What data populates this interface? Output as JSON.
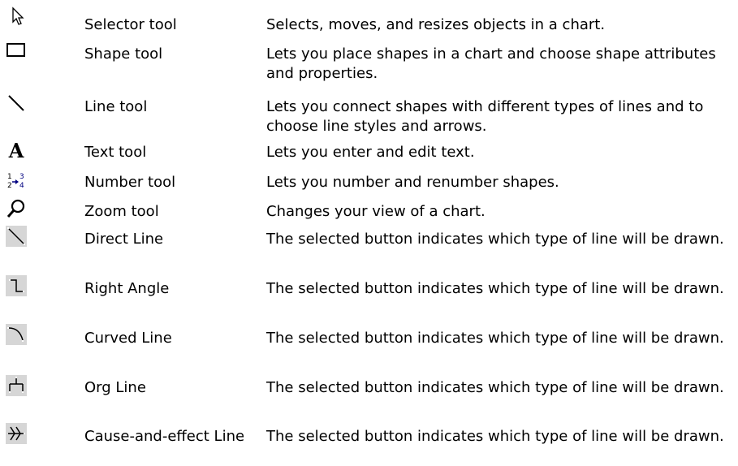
{
  "tools": [
    {
      "icon": "selector-arrow-icon",
      "name": "Selector tool",
      "description": "Selects, moves, and resizes objects in a chart."
    },
    {
      "icon": "rectangle-shape-icon",
      "name": "Shape tool",
      "description": "Lets you place shapes in a chart and choose shape attributes and properties."
    },
    {
      "icon": "diagonal-line-icon",
      "name": "Line tool",
      "description": "Lets you connect shapes with different types of lines and to choose line styles and arrows."
    },
    {
      "icon": "letter-a-icon",
      "name": "Text tool",
      "description": "Lets you enter and edit text."
    },
    {
      "icon": "numbering-icon",
      "name": "Number tool",
      "description": "Lets you number and renumber shapes."
    },
    {
      "icon": "magnifier-icon",
      "name": "Zoom tool",
      "description": "Changes your view of a chart."
    },
    {
      "icon": "direct-line-icon",
      "name": "Direct Line",
      "description": " The selected button indicates which type of line will be drawn."
    },
    {
      "icon": "right-angle-line-icon",
      "name": "Right Angle",
      "description": " The selected button indicates which type of line will be drawn."
    },
    {
      "icon": "curved-line-icon",
      "name": "Curved Line",
      "description": " The selected button indicates which type of line will be drawn."
    },
    {
      "icon": "org-line-icon",
      "name": "Org Line",
      "description": "The selected button indicates which type of line will be drawn."
    },
    {
      "icon": "cause-and-effect-line-icon",
      "name": "Cause-and-effect Line",
      "description": "The selected button indicates which type of line will be drawn."
    }
  ]
}
